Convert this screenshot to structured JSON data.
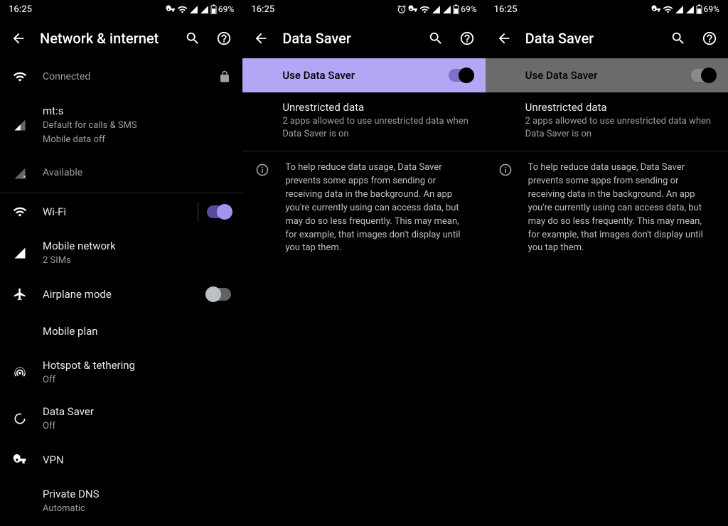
{
  "status": {
    "time": "16:25",
    "battery": "69%"
  },
  "pane1": {
    "title": "Network & internet",
    "conn": {
      "label": "Connected"
    },
    "carrier": {
      "name": "mt:s",
      "sub1": "Default for calls & SMS",
      "sub2": "Mobile data off"
    },
    "avail": "Available",
    "wifi": {
      "label": "Wi-Fi"
    },
    "mobile": {
      "label": "Mobile network",
      "sub": "2 SIMs"
    },
    "airplane": {
      "label": "Airplane mode"
    },
    "mobileplan": {
      "label": "Mobile plan"
    },
    "hotspot": {
      "label": "Hotspot & tethering",
      "sub": "Off"
    },
    "datasaver": {
      "label": "Data Saver",
      "sub": "Off"
    },
    "vpn": {
      "label": "VPN"
    },
    "dns": {
      "label": "Private DNS",
      "sub": "Automatic"
    }
  },
  "pane2": {
    "title": "Data Saver",
    "use_label": "Use Data Saver",
    "unres_title": "Unrestricted data",
    "unres_sub": "2 apps allowed to use unrestricted data when Data Saver is on",
    "info": "To help reduce data usage, Data Saver prevents some apps from sending or receiving data in the background. An app you're currently using can access data, but may do so less frequently. This may mean, for example, that images don't display until you tap them."
  },
  "pane3": {
    "title": "Data Saver",
    "use_label": "Use Data Saver",
    "unres_title": "Unrestricted data",
    "unres_sub": "2 apps allowed to use unrestricted data when Data Saver is on",
    "info": "To help reduce data usage, Data Saver prevents some apps from sending or receiving data in the background. An app you're currently using can access data, but may do so less frequently. This may mean, for example, that images don't display until you tap them."
  }
}
